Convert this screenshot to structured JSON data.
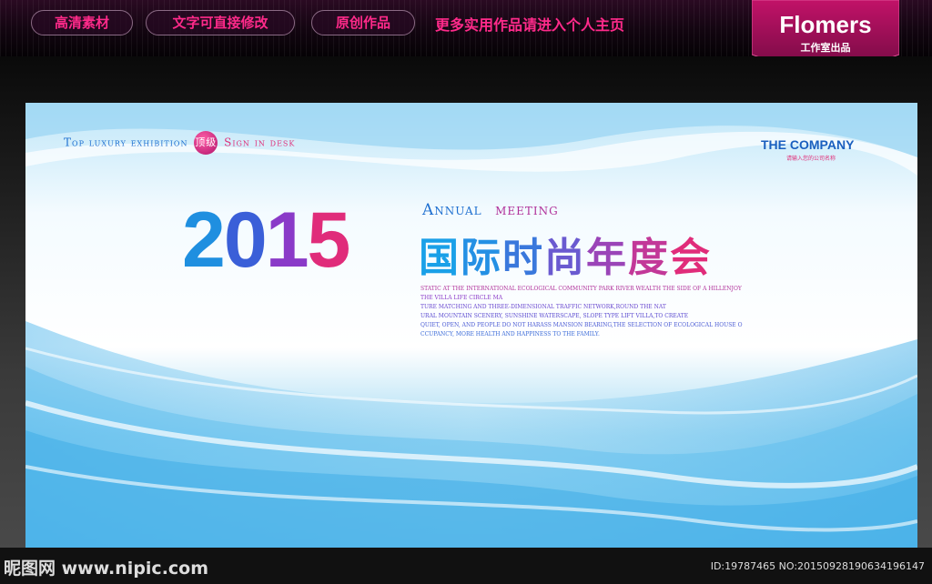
{
  "topbar": {
    "pills": [
      "高清素材",
      "文字可直接修改",
      "原创作品"
    ],
    "promo": "更多实用作品请进入个人主页",
    "brand": {
      "name": "Flomers",
      "sub": "工作室出品"
    }
  },
  "poster": {
    "tagline_blue": "Top luxury exhibition",
    "badge": "顶级",
    "tagline_pink": "Sign in desk",
    "company": "THE COMPANY",
    "company_sub": "请输入您的公司名称",
    "year_digits": [
      "2",
      "0",
      "1",
      "5"
    ],
    "annual": "Annual",
    "meeting": "meeting",
    "title_chars": [
      "国",
      "际",
      "时",
      "尚",
      "年",
      "度",
      "会"
    ],
    "body_lines": [
      "STATIC AT THE INTERNATIONAL ECOLOGICAL COMMUNITY PARK RIVER WEALTH THE SIDE OF A HILLENJOY",
      "THE VILLA LIFE CIRCLE MA",
      "TURE MATCHING AND THREE-DIMENSIONAL TRAFFIC NETWORK,ROUND THE NAT",
      "URAL MOUNTAIN SCENERY, SUNSHINE WATERSCAPE, SLOPE TYPE LIFT VILLA,TO CREATE",
      "QUIET, OPEN, AND PEOPLE DO NOT HARASS MANSION BEARING,THE SELECTION OF ECOLOGICAL HOUSE O",
      "CCUPANCY, MORE HEALTH AND HAPPINESS TO THE FAMILY."
    ]
  },
  "colors": {
    "accent_pink": "#ff2a8a",
    "blue": "#1e6fd0",
    "gradient": [
      "#1aa0e8",
      "#3a5fd8",
      "#8a3ac8",
      "#e02c7a"
    ]
  },
  "watermark": {
    "logo": "昵图网 www.nipic.com",
    "id": "ID:19787465 NO:20150928190634196147"
  }
}
